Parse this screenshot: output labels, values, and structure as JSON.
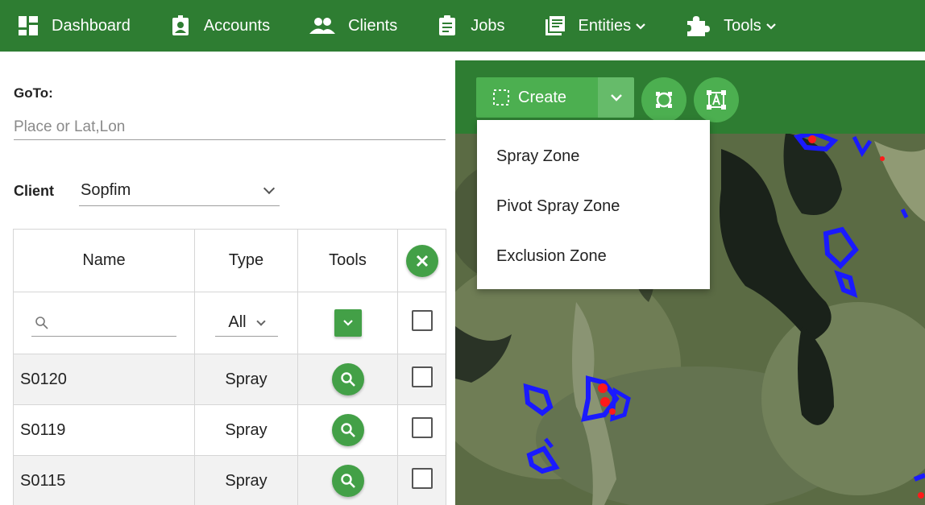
{
  "nav": {
    "items": [
      {
        "label": "Dashboard",
        "icon": "dashboard-icon",
        "caret": false
      },
      {
        "label": "Accounts",
        "icon": "contact-card-icon",
        "caret": false
      },
      {
        "label": "Clients",
        "icon": "people-icon",
        "caret": false
      },
      {
        "label": "Jobs",
        "icon": "clipboard-icon",
        "caret": false
      },
      {
        "label": "Entities",
        "icon": "library-icon",
        "caret": true
      },
      {
        "label": "Tools",
        "icon": "puzzle-icon",
        "caret": true
      }
    ]
  },
  "goto": {
    "label": "GoTo:",
    "placeholder": "Place or Lat,Lon",
    "value": ""
  },
  "client": {
    "label": "Client",
    "selected": "Sopfim"
  },
  "table": {
    "headers": {
      "name": "Name",
      "type": "Type",
      "tools": "Tools"
    },
    "type_filter": "All",
    "rows": [
      {
        "name": "S0120",
        "type": "Spray"
      },
      {
        "name": "S0119",
        "type": "Spray"
      },
      {
        "name": "S0115",
        "type": "Spray"
      }
    ]
  },
  "map_toolbar": {
    "create_label": "Create",
    "menu": [
      "Spray Zone",
      "Pivot Spray Zone",
      "Exclusion Zone"
    ]
  },
  "colors": {
    "nav_green": "#2e7d32",
    "button_green": "#43a047",
    "zone_blue": "#1a1aff",
    "zone_red": "#ff1a1a"
  }
}
